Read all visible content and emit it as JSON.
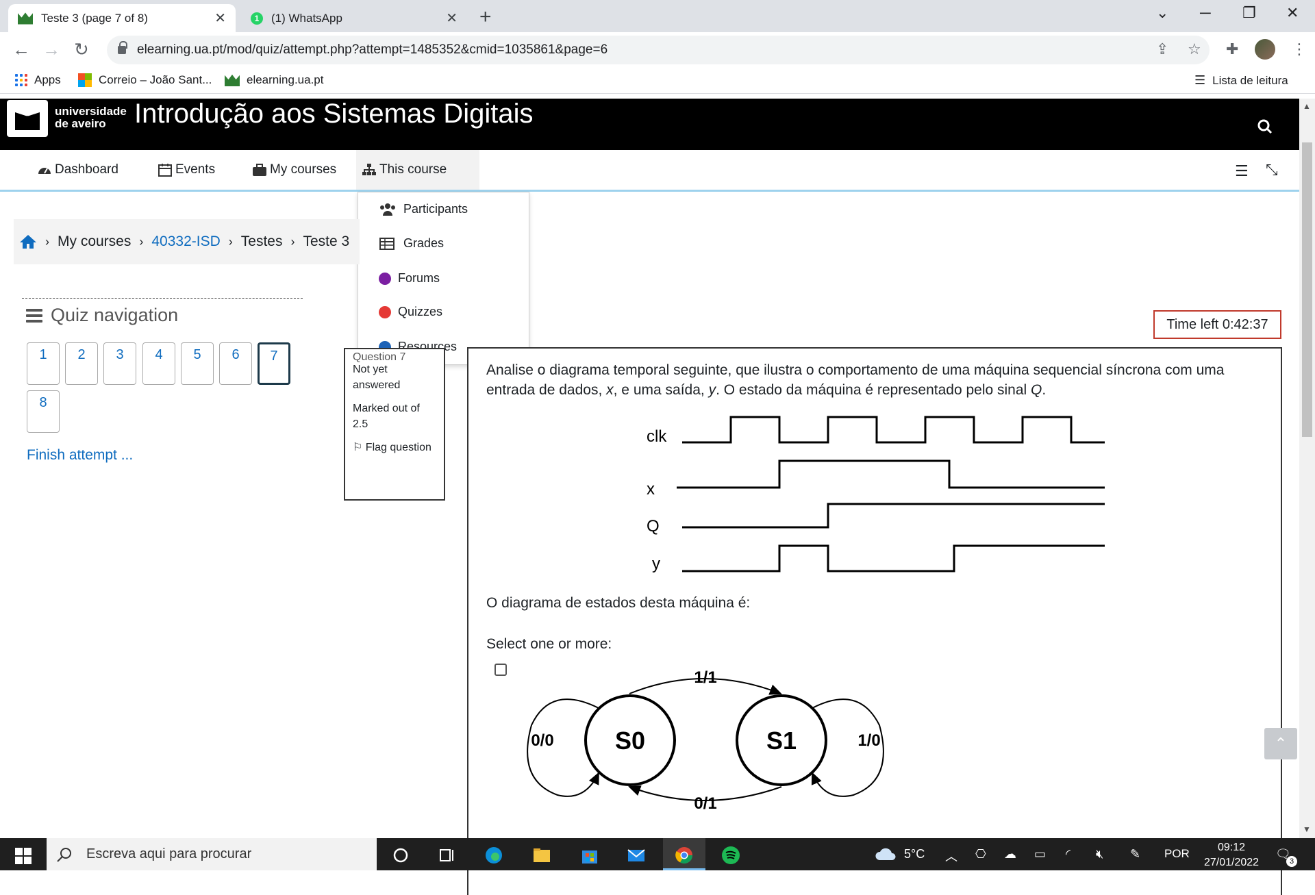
{
  "browser": {
    "tabs": [
      {
        "title": "Teste 3 (page 7 of 8)",
        "active": true,
        "icon": "ua-favicon"
      },
      {
        "title": "(1) WhatsApp",
        "active": false,
        "icon": "whatsapp-favicon",
        "badge": "1"
      }
    ],
    "url": "elearning.ua.pt/mod/quiz/attempt.php?attempt=1485352&cmid=1035861&page=6",
    "bookmarks": [
      {
        "label": "Apps",
        "icon": "apps-grid-icon"
      },
      {
        "label": "Correio – João Sant...",
        "icon": "microsoft-icon"
      },
      {
        "label": "elearning.ua.pt",
        "icon": "ua-favicon"
      }
    ],
    "reading_list": "Lista de leitura"
  },
  "site": {
    "logo_line1": "universidade",
    "logo_line2": "de aveiro",
    "title": "Introdução aos Sistemas Digitais"
  },
  "nav": {
    "items": [
      {
        "label": "Dashboard",
        "icon": "dashboard-icon"
      },
      {
        "label": "Events",
        "icon": "calendar-icon"
      },
      {
        "label": "My courses",
        "icon": "briefcase-icon"
      },
      {
        "label": "This course",
        "icon": "sitemap-icon"
      }
    ],
    "dropdown": [
      {
        "label": "Participants",
        "icon": "users-icon"
      },
      {
        "label": "Grades",
        "icon": "table-icon"
      },
      {
        "label": "Forums",
        "icon": "forum-icon",
        "color": "#7b1fa2"
      },
      {
        "label": "Quizzes",
        "icon": "quiz-icon",
        "color": "#e53935"
      },
      {
        "label": "Resources",
        "icon": "resource-icon",
        "color": "#1e63b7"
      }
    ]
  },
  "breadcrumb": [
    "My courses",
    "40332-ISD",
    "Testes",
    "Teste 3"
  ],
  "quiz_nav": {
    "title": "Quiz navigation",
    "questions": [
      "1",
      "2",
      "3",
      "4",
      "5",
      "6",
      "7",
      "8"
    ],
    "current": "7",
    "finish": "Finish attempt ..."
  },
  "question_info": {
    "number_label": "Question 7",
    "status": "Not yet answered",
    "marks": "Marked out of 2.5",
    "flag": "Flag question"
  },
  "timer": "Time left 0:42:37",
  "question": {
    "text_part1": "Analise o diagrama temporal seguinte, que ilustra o comportamento de uma máquina sequencial síncrona com uma entrada de dados, ",
    "var_x": "x",
    "text_part2": ", e uma saída, ",
    "var_y": "y",
    "text_part3": ". O estado da máquina é representado pelo sinal ",
    "var_q": "Q",
    "text_part4": ".",
    "signals": [
      "clk",
      "x",
      "Q",
      "y"
    ],
    "prompt": "O diagrama de estados desta máquina é:",
    "select_label": "Select one or more:",
    "state_diagram": {
      "states": [
        "S0",
        "S1"
      ],
      "transitions": {
        "s0_self": "0/0",
        "s0_to_s1": "1/1",
        "s1_to_s0": "0/1",
        "s1_self": "1/0"
      }
    }
  },
  "taskbar": {
    "search_placeholder": "Escreva aqui para procurar",
    "weather": "5°C",
    "language": "POR",
    "time": "09:12",
    "date": "27/01/2022",
    "notifications": "3"
  }
}
